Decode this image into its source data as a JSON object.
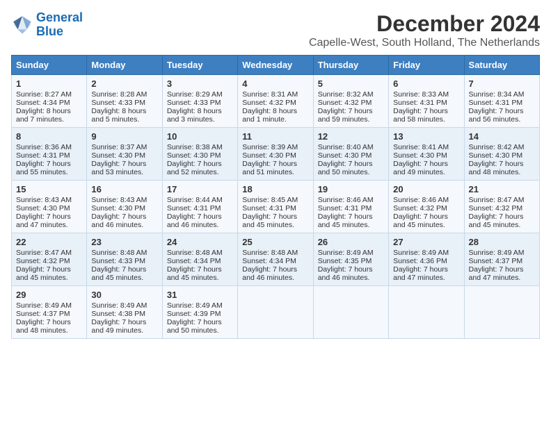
{
  "header": {
    "logo_line1": "General",
    "logo_line2": "Blue",
    "main_title": "December 2024",
    "subtitle": "Capelle-West, South Holland, The Netherlands"
  },
  "columns": [
    "Sunday",
    "Monday",
    "Tuesday",
    "Wednesday",
    "Thursday",
    "Friday",
    "Saturday"
  ],
  "weeks": [
    {
      "days": [
        {
          "num": "1",
          "sunrise": "Sunrise: 8:27 AM",
          "sunset": "Sunset: 4:34 PM",
          "daylight": "Daylight: 8 hours and 7 minutes."
        },
        {
          "num": "2",
          "sunrise": "Sunrise: 8:28 AM",
          "sunset": "Sunset: 4:33 PM",
          "daylight": "Daylight: 8 hours and 5 minutes."
        },
        {
          "num": "3",
          "sunrise": "Sunrise: 8:29 AM",
          "sunset": "Sunset: 4:33 PM",
          "daylight": "Daylight: 8 hours and 3 minutes."
        },
        {
          "num": "4",
          "sunrise": "Sunrise: 8:31 AM",
          "sunset": "Sunset: 4:32 PM",
          "daylight": "Daylight: 8 hours and 1 minute."
        },
        {
          "num": "5",
          "sunrise": "Sunrise: 8:32 AM",
          "sunset": "Sunset: 4:32 PM",
          "daylight": "Daylight: 7 hours and 59 minutes."
        },
        {
          "num": "6",
          "sunrise": "Sunrise: 8:33 AM",
          "sunset": "Sunset: 4:31 PM",
          "daylight": "Daylight: 7 hours and 58 minutes."
        },
        {
          "num": "7",
          "sunrise": "Sunrise: 8:34 AM",
          "sunset": "Sunset: 4:31 PM",
          "daylight": "Daylight: 7 hours and 56 minutes."
        }
      ]
    },
    {
      "days": [
        {
          "num": "8",
          "sunrise": "Sunrise: 8:36 AM",
          "sunset": "Sunset: 4:31 PM",
          "daylight": "Daylight: 7 hours and 55 minutes."
        },
        {
          "num": "9",
          "sunrise": "Sunrise: 8:37 AM",
          "sunset": "Sunset: 4:30 PM",
          "daylight": "Daylight: 7 hours and 53 minutes."
        },
        {
          "num": "10",
          "sunrise": "Sunrise: 8:38 AM",
          "sunset": "Sunset: 4:30 PM",
          "daylight": "Daylight: 7 hours and 52 minutes."
        },
        {
          "num": "11",
          "sunrise": "Sunrise: 8:39 AM",
          "sunset": "Sunset: 4:30 PM",
          "daylight": "Daylight: 7 hours and 51 minutes."
        },
        {
          "num": "12",
          "sunrise": "Sunrise: 8:40 AM",
          "sunset": "Sunset: 4:30 PM",
          "daylight": "Daylight: 7 hours and 50 minutes."
        },
        {
          "num": "13",
          "sunrise": "Sunrise: 8:41 AM",
          "sunset": "Sunset: 4:30 PM",
          "daylight": "Daylight: 7 hours and 49 minutes."
        },
        {
          "num": "14",
          "sunrise": "Sunrise: 8:42 AM",
          "sunset": "Sunset: 4:30 PM",
          "daylight": "Daylight: 7 hours and 48 minutes."
        }
      ]
    },
    {
      "days": [
        {
          "num": "15",
          "sunrise": "Sunrise: 8:43 AM",
          "sunset": "Sunset: 4:30 PM",
          "daylight": "Daylight: 7 hours and 47 minutes."
        },
        {
          "num": "16",
          "sunrise": "Sunrise: 8:43 AM",
          "sunset": "Sunset: 4:30 PM",
          "daylight": "Daylight: 7 hours and 46 minutes."
        },
        {
          "num": "17",
          "sunrise": "Sunrise: 8:44 AM",
          "sunset": "Sunset: 4:31 PM",
          "daylight": "Daylight: 7 hours and 46 minutes."
        },
        {
          "num": "18",
          "sunrise": "Sunrise: 8:45 AM",
          "sunset": "Sunset: 4:31 PM",
          "daylight": "Daylight: 7 hours and 45 minutes."
        },
        {
          "num": "19",
          "sunrise": "Sunrise: 8:46 AM",
          "sunset": "Sunset: 4:31 PM",
          "daylight": "Daylight: 7 hours and 45 minutes."
        },
        {
          "num": "20",
          "sunrise": "Sunrise: 8:46 AM",
          "sunset": "Sunset: 4:32 PM",
          "daylight": "Daylight: 7 hours and 45 minutes."
        },
        {
          "num": "21",
          "sunrise": "Sunrise: 8:47 AM",
          "sunset": "Sunset: 4:32 PM",
          "daylight": "Daylight: 7 hours and 45 minutes."
        }
      ]
    },
    {
      "days": [
        {
          "num": "22",
          "sunrise": "Sunrise: 8:47 AM",
          "sunset": "Sunset: 4:32 PM",
          "daylight": "Daylight: 7 hours and 45 minutes."
        },
        {
          "num": "23",
          "sunrise": "Sunrise: 8:48 AM",
          "sunset": "Sunset: 4:33 PM",
          "daylight": "Daylight: 7 hours and 45 minutes."
        },
        {
          "num": "24",
          "sunrise": "Sunrise: 8:48 AM",
          "sunset": "Sunset: 4:34 PM",
          "daylight": "Daylight: 7 hours and 45 minutes."
        },
        {
          "num": "25",
          "sunrise": "Sunrise: 8:48 AM",
          "sunset": "Sunset: 4:34 PM",
          "daylight": "Daylight: 7 hours and 46 minutes."
        },
        {
          "num": "26",
          "sunrise": "Sunrise: 8:49 AM",
          "sunset": "Sunset: 4:35 PM",
          "daylight": "Daylight: 7 hours and 46 minutes."
        },
        {
          "num": "27",
          "sunrise": "Sunrise: 8:49 AM",
          "sunset": "Sunset: 4:36 PM",
          "daylight": "Daylight: 7 hours and 47 minutes."
        },
        {
          "num": "28",
          "sunrise": "Sunrise: 8:49 AM",
          "sunset": "Sunset: 4:37 PM",
          "daylight": "Daylight: 7 hours and 47 minutes."
        }
      ]
    },
    {
      "days": [
        {
          "num": "29",
          "sunrise": "Sunrise: 8:49 AM",
          "sunset": "Sunset: 4:37 PM",
          "daylight": "Daylight: 7 hours and 48 minutes."
        },
        {
          "num": "30",
          "sunrise": "Sunrise: 8:49 AM",
          "sunset": "Sunset: 4:38 PM",
          "daylight": "Daylight: 7 hours and 49 minutes."
        },
        {
          "num": "31",
          "sunrise": "Sunrise: 8:49 AM",
          "sunset": "Sunset: 4:39 PM",
          "daylight": "Daylight: 7 hours and 50 minutes."
        },
        null,
        null,
        null,
        null
      ]
    }
  ]
}
